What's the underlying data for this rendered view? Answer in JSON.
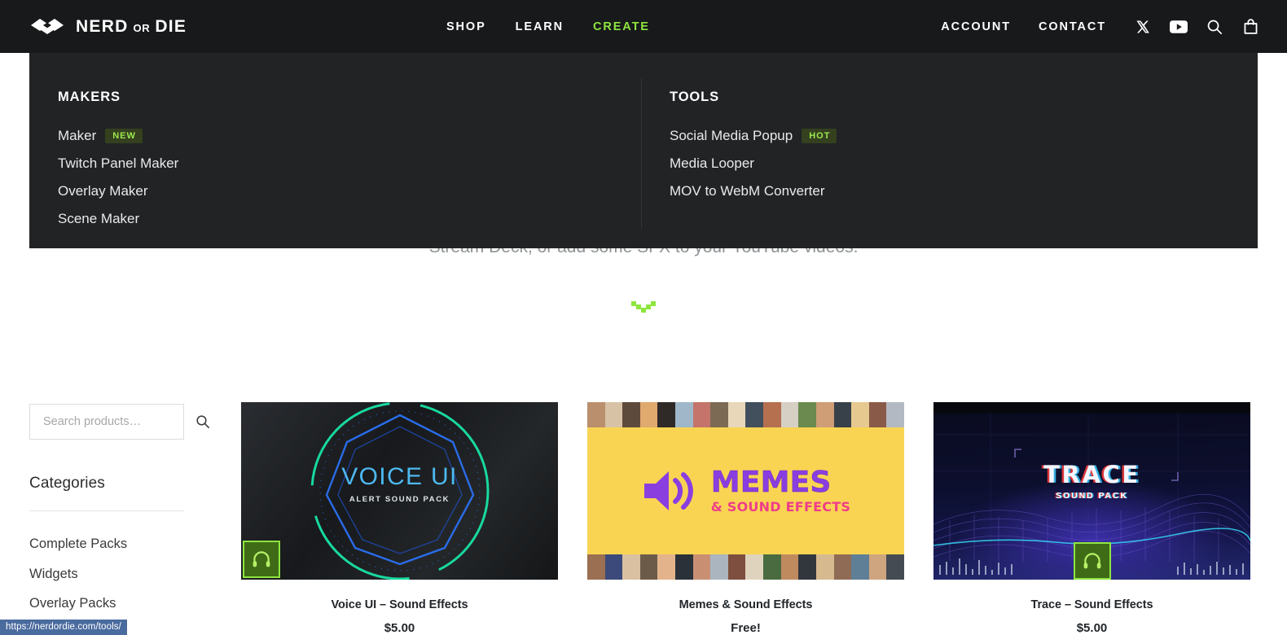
{
  "header": {
    "logo": {
      "name": "NERD",
      "or": "OR",
      "name2": "DIE",
      "icon": "nerd-or-die-logo-icon"
    },
    "nav_center": [
      {
        "label": "SHOP",
        "active": false
      },
      {
        "label": "LEARN",
        "active": false
      },
      {
        "label": "CREATE",
        "active": true
      }
    ],
    "nav_right": [
      {
        "label": "ACCOUNT"
      },
      {
        "label": "CONTACT"
      }
    ],
    "icons": [
      {
        "name": "x-twitter-icon"
      },
      {
        "name": "youtube-icon"
      },
      {
        "name": "search-icon"
      },
      {
        "name": "shopping-bag-icon"
      }
    ],
    "accent_color": "#8ee63f",
    "background_color": "#17191a"
  },
  "dropdown": {
    "background_color": "#212325",
    "makers": {
      "heading": "MAKERS",
      "items": [
        {
          "label": "Maker",
          "badge": "NEW"
        },
        {
          "label": "Twitch Panel Maker",
          "badge": ""
        },
        {
          "label": "Overlay Maker",
          "badge": ""
        },
        {
          "label": "Scene Maker",
          "badge": ""
        }
      ]
    },
    "tools": {
      "heading": "TOOLS",
      "items": [
        {
          "label": "Social Media Popup",
          "badge": "HOT"
        },
        {
          "label": "Media Looper",
          "badge": ""
        },
        {
          "label": "MOV to WebM Converter",
          "badge": ""
        }
      ]
    },
    "badge_bg": "#35401f",
    "badge_color": "#9ae84f"
  },
  "hero": {
    "subtitle": "Stream Deck, or add some SFX to your YouTube videos.",
    "scroll_icon": "chevron-down-icon"
  },
  "sidebar": {
    "search": {
      "placeholder": "Search products…",
      "value": "",
      "icon": "search-icon"
    },
    "categories_title": "Categories",
    "categories": [
      {
        "label": "Complete Packs"
      },
      {
        "label": "Widgets"
      },
      {
        "label": "Overlay Packs"
      }
    ]
  },
  "products": [
    {
      "title": "Voice UI – Sound Effects",
      "price": "$5.00",
      "art_name": "VOICE UI",
      "art_sub": "ALERT SOUND PACK",
      "badge_icon": "headphones-icon",
      "badge_position": "bottom-left"
    },
    {
      "title": "Memes & Sound Effects",
      "price": "Free!",
      "art_name": "MEMES",
      "art_sub": "& SOUND EFFECTS",
      "badge_icon": "speaker-icon",
      "badge_position": "none"
    },
    {
      "title": "Trace – Sound Effects",
      "price": "$5.00",
      "art_name": "TRACE",
      "art_sub": "SOUND PACK",
      "badge_icon": "headphones-icon",
      "badge_position": "bottom-center"
    }
  ],
  "statusbar": {
    "url": "https://nerdordie.com/tools/"
  }
}
